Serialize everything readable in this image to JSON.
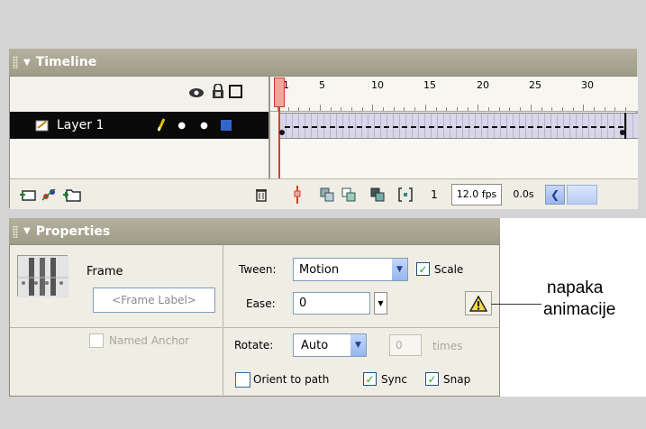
{
  "timeline": {
    "title": "Timeline",
    "header_icons": [
      "eye-icon",
      "lock-icon",
      "outline-icon"
    ],
    "ruler_labels": [
      "1",
      "5",
      "10",
      "15",
      "20",
      "25",
      "30"
    ],
    "layer": {
      "name": "Layer 1",
      "icon": "layer-icon",
      "pencil_icon": "pencil-icon",
      "color": "#3366cc"
    },
    "status": {
      "current_frame": "1",
      "frame_rate": "12.0 fps",
      "elapsed_time": "0.0s"
    }
  },
  "properties": {
    "title": "Properties",
    "frame_label": "Frame",
    "frame_label_placeholder": "<Frame Label>",
    "named_anchor_label": "Named Anchor",
    "tween_label": "Tween:",
    "tween_value": "Motion",
    "scale_label": "Scale",
    "scale_checked": true,
    "ease_label": "Ease:",
    "ease_value": "0",
    "warning_icon": "warning-icon",
    "rotate_label": "Rotate:",
    "rotate_value": "Auto",
    "rotate_times_value": "0",
    "times_label": "times",
    "orient_label": "Orient to path",
    "orient_checked": false,
    "sync_label": "Sync",
    "sync_checked": true,
    "snap_label": "Snap",
    "snap_checked": true
  },
  "annotation": {
    "line1": "napaka",
    "line2": "animacije"
  },
  "colors": {
    "panel_header": "#a6a38f",
    "playhead": "#e03b2b",
    "layer_row": "#0a0a0a",
    "tween_frames": "#d8d6e8",
    "check": "#21a121"
  }
}
